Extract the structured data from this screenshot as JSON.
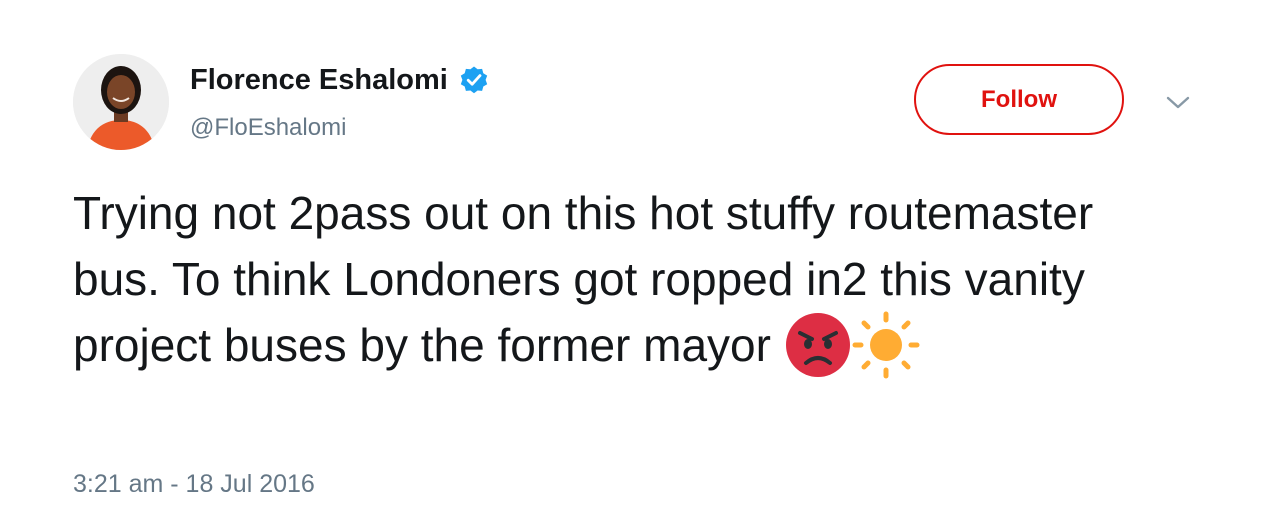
{
  "author": {
    "name": "Florence Eshalomi",
    "handle": "@FloEshalomi",
    "verified": true,
    "verified_icon": "verified-badge-icon"
  },
  "actions": {
    "follow_label": "Follow",
    "more_icon": "chevron-down-icon"
  },
  "tweet": {
    "text": "Trying not 2pass out on this hot stuffy routemaster bus. To think Londoners got ropped in2 this vanity project buses by the former mayor",
    "emojis": [
      "angry-face-icon",
      "sun-icon"
    ],
    "timestamp": "3:21 am - 18 Jul 2016"
  },
  "colors": {
    "follow_accent": "#e0120f",
    "verified_blue": "#1da1f2",
    "secondary_text": "#657786",
    "primary_text": "#14171a",
    "angry_red": "#dd2e44",
    "sun_orange": "#ffac33"
  }
}
